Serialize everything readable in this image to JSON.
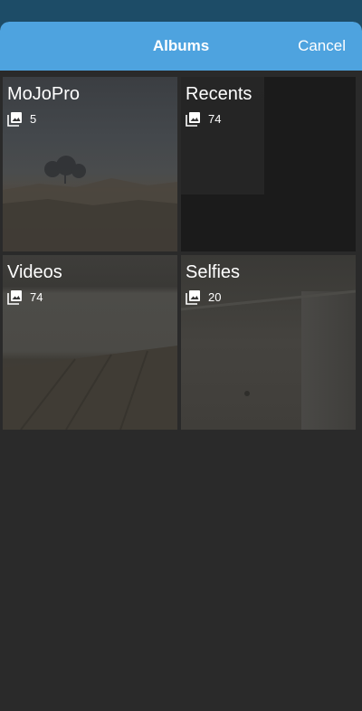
{
  "header": {
    "title": "Albums",
    "cancel_label": "Cancel"
  },
  "albums": [
    {
      "name": "MoJoPro",
      "count": "5",
      "icon": "photo-library-icon"
    },
    {
      "name": "Recents",
      "count": "74",
      "icon": "photo-library-icon"
    },
    {
      "name": "Videos",
      "count": "74",
      "icon": "photo-library-icon"
    },
    {
      "name": "Selfies",
      "count": "20",
      "icon": "photo-library-icon"
    }
  ],
  "colors": {
    "status_bar": "#1d4c67",
    "nav_bar": "#4ea3df",
    "background": "#2a2a2a",
    "text": "#ffffff"
  }
}
